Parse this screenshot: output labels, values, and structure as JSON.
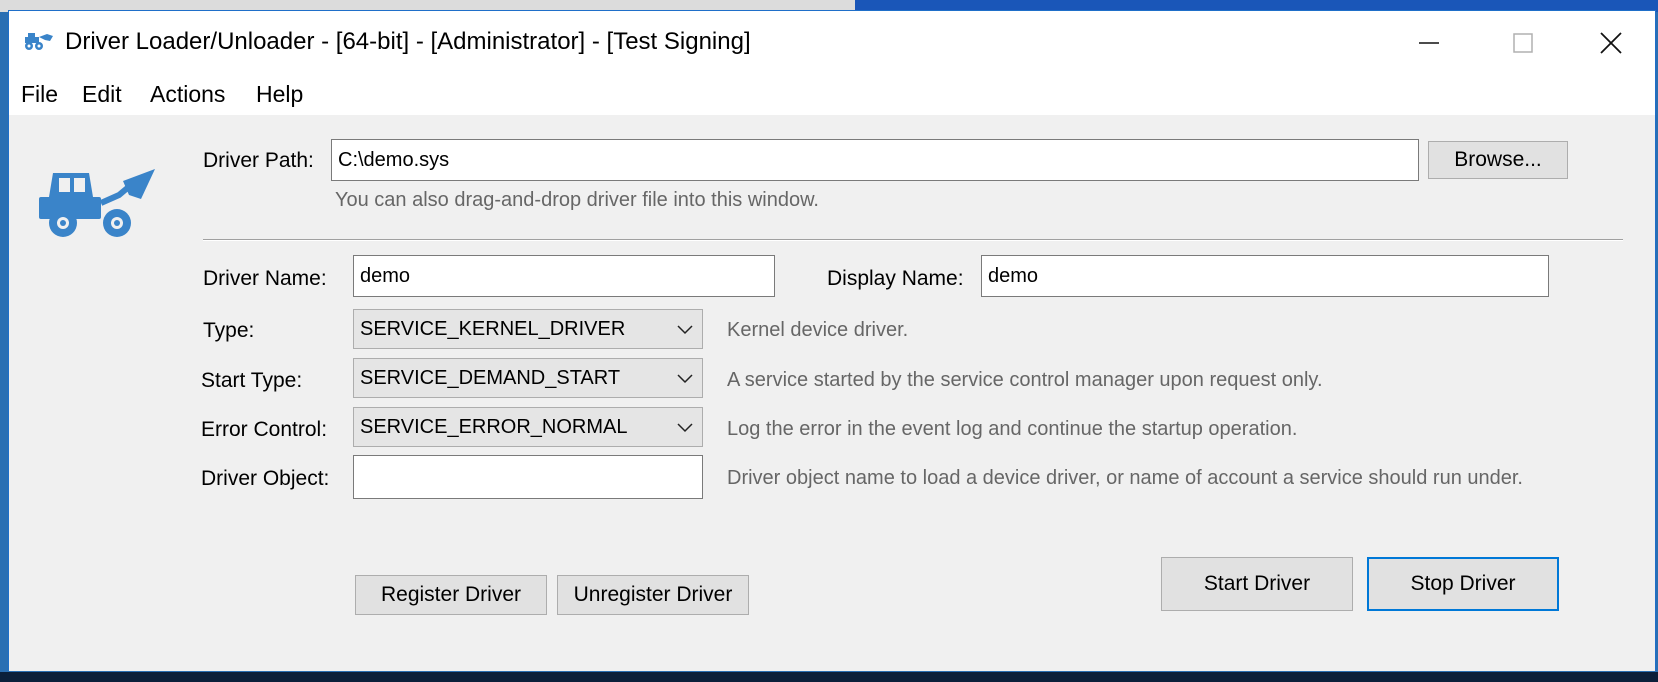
{
  "window": {
    "title": "Driver Loader/Unloader - [64-bit] - [Administrator] - [Test Signing]",
    "app_icon": "bulldozer-icon",
    "controls": {
      "minimize": "minimize-icon",
      "maximize": "maximize-icon",
      "close": "close-icon"
    }
  },
  "menu": {
    "items": [
      "File",
      "Edit",
      "Actions",
      "Help"
    ]
  },
  "form": {
    "logo_icon": "bulldozer-icon",
    "driver_path": {
      "label": "Driver Path:",
      "value": "C:\\demo.sys",
      "hint": "You can also drag-and-drop driver file into this window.",
      "browse_label": "Browse..."
    },
    "driver_name": {
      "label": "Driver Name:",
      "value": "demo"
    },
    "display_name": {
      "label": "Display Name:",
      "value": "demo"
    },
    "type": {
      "label": "Type:",
      "value": "SERVICE_KERNEL_DRIVER",
      "description": "Kernel device driver."
    },
    "start_type": {
      "label": "Start Type:",
      "value": "SERVICE_DEMAND_START",
      "description": "A service started by the service control manager upon request only."
    },
    "error_control": {
      "label": "Error Control:",
      "value": "SERVICE_ERROR_NORMAL",
      "description": "Log the error in the event log and continue the startup operation."
    },
    "driver_object": {
      "label": "Driver Object:",
      "value": "",
      "description": "Driver object name to load a device driver, or name of account a service should run under."
    }
  },
  "buttons": {
    "register": "Register Driver",
    "unregister": "Unregister Driver",
    "start": "Start Driver",
    "stop": "Stop Driver"
  },
  "colors": {
    "accent": "#0078d7",
    "logo_blue": "#3a84c9",
    "window_bg": "#f0f0f0"
  }
}
